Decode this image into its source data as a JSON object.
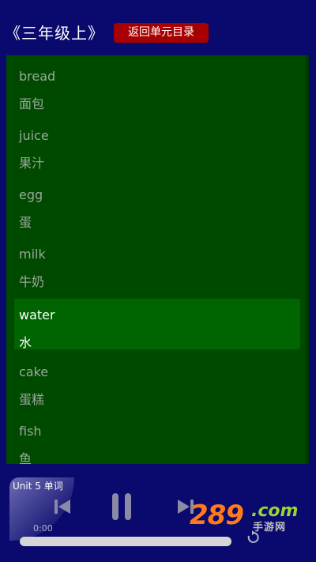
{
  "header": {
    "book_title": "《三年级上》",
    "back_button": "返回单元目录"
  },
  "words": [
    {
      "en": "bread",
      "cn": "面包",
      "selected": false
    },
    {
      "en": "juice",
      "cn": "果汁",
      "selected": false
    },
    {
      "en": "egg",
      "cn": "蛋",
      "selected": false
    },
    {
      "en": "milk",
      "cn": "牛奶",
      "selected": false
    },
    {
      "en": "water",
      "cn": "水",
      "selected": true
    },
    {
      "en": "cake",
      "cn": "蛋糕",
      "selected": false
    },
    {
      "en": "fish",
      "cn": "鱼",
      "selected": false
    }
  ],
  "player": {
    "track_title": "Unit 5 单词",
    "current_time": "0:00",
    "progress": 0.0,
    "icons": {
      "prev": "skip-previous-icon",
      "pause": "pause-icon",
      "next": "skip-next-icon",
      "loop": "loop-icon"
    }
  },
  "watermark": {
    "number": "289",
    "domain": ".com",
    "sub": "手游网"
  },
  "colors": {
    "page_bg": "#0a0a6e",
    "list_bg": "#004a00",
    "selected_bg": "#006400",
    "back_button_bg": "#a80000"
  }
}
